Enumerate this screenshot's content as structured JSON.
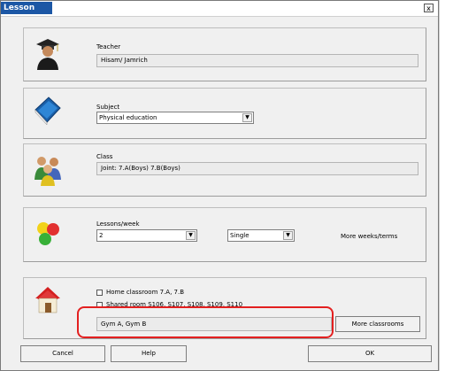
{
  "window": {
    "title": "Lesson",
    "close_label": "x"
  },
  "teacher": {
    "label": "Teacher",
    "value": "Hisam/ Jamrich"
  },
  "subject": {
    "label": "Subject",
    "value": "Physical education"
  },
  "class": {
    "label": "Class",
    "value": "Joint: 7.A(Boys) 7.B(Boys)"
  },
  "lessons": {
    "label": "Lessons/week",
    "count": "2",
    "type": "Single",
    "more_label": "More weeks/terms"
  },
  "rooms": {
    "home_label": "Home classroom 7.A, 7.B",
    "shared_label": "Shared room S106, S107, S108, S109, S110",
    "value": "Gym A, Gym B",
    "more_button": "More classrooms"
  },
  "footer": {
    "cancel": "Cancel",
    "help": "Help",
    "ok": "OK"
  },
  "colors": {
    "title_bar": "#1c57a5",
    "highlight": "#e32020"
  },
  "icons": [
    "teacher-icon",
    "subject-book-icon",
    "class-students-icon",
    "lessons-balls-icon",
    "classroom-house-icon",
    "dropdown-arrow-icon",
    "close-icon"
  ]
}
